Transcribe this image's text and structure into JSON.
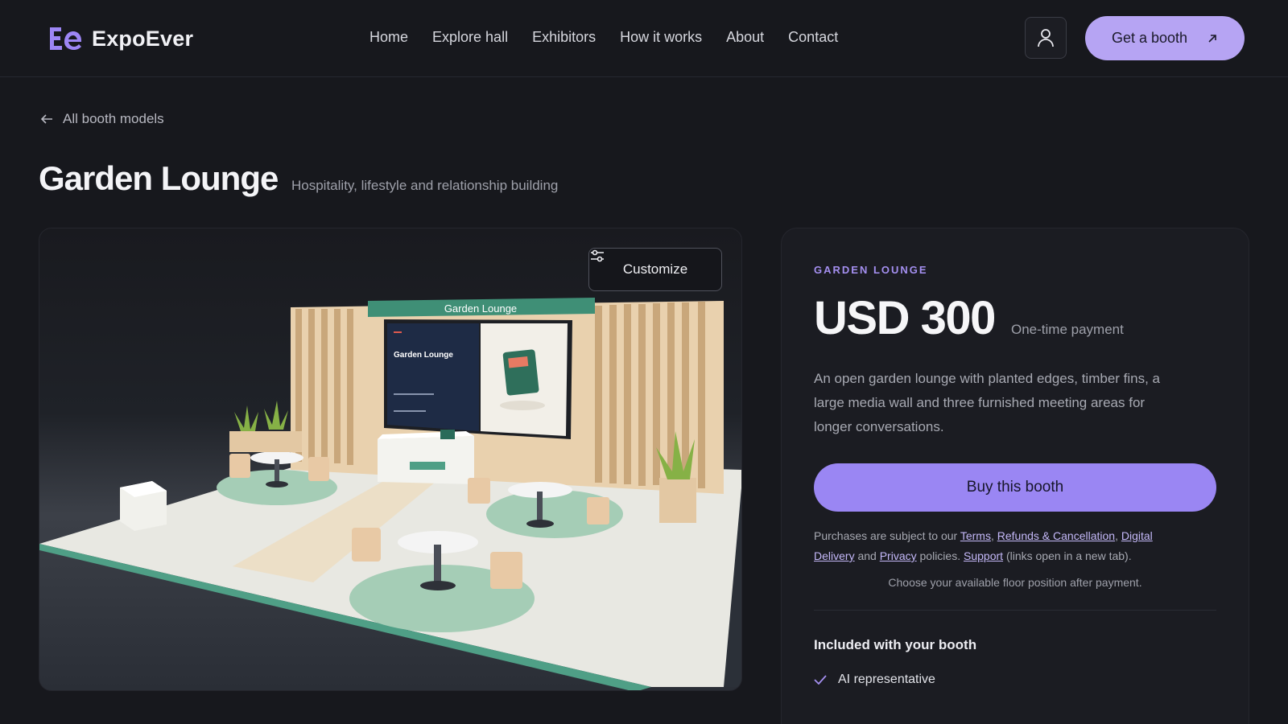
{
  "brand": {
    "name": "ExpoEver",
    "logo_letters": "Ee"
  },
  "nav": {
    "links": [
      "Home",
      "Explore hall",
      "Exhibitors",
      "How it works",
      "About",
      "Contact"
    ],
    "cta_label": "Get a booth"
  },
  "breadcrumb": {
    "back_label": "All booth models"
  },
  "page": {
    "title": "Garden Lounge",
    "subtitle": "Hospitality, lifestyle and relationship building"
  },
  "viewer": {
    "customize_label": "Customize",
    "banner_text": "Garden Lounge",
    "screen_title": "Garden Lounge"
  },
  "product": {
    "eyebrow": "GARDEN LOUNGE",
    "price": "USD 300",
    "price_note": "One-time payment",
    "description": "An open garden lounge with planted edges, timber fins, a large media wall and three furnished meeting areas for longer conversations.",
    "buy_label": "Buy this booth",
    "legal": {
      "prefix": "Purchases are subject to our",
      "terms": "Terms",
      "refunds": "Refunds & Cancellation",
      "digital": "Digital Delivery",
      "and": "and",
      "privacy": "Privacy",
      "policies": "policies.",
      "support": "Support",
      "suffix": "(links open in a new tab)."
    },
    "floor_note": "Choose your available floor position after payment.",
    "included_title": "Included with your booth",
    "included_items": [
      "AI representative"
    ]
  },
  "colors": {
    "accent": "#9a86f3",
    "accent_light": "#b6a4f3",
    "eyebrow": "#a48ff0",
    "background": "#17181d"
  }
}
